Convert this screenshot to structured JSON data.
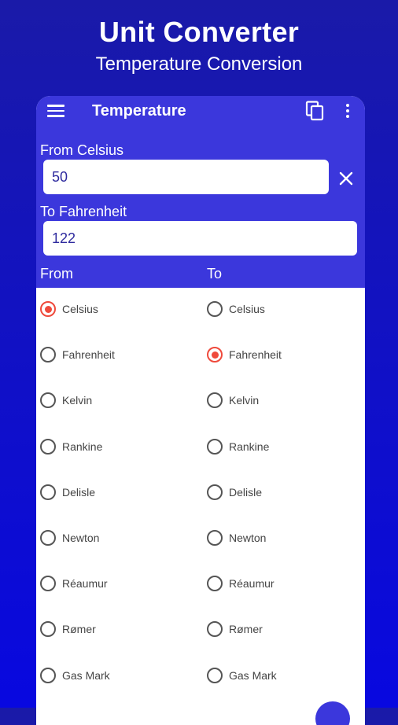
{
  "hero": {
    "title": "Unit Converter",
    "subtitle": "Temperature Conversion"
  },
  "appbar": {
    "title": "Temperature",
    "menu_icon": "menu-icon",
    "copy_icon": "copy-icon",
    "more_icon": "more-vert-icon"
  },
  "from_field": {
    "label": "From Celsius",
    "value": "50",
    "clear_icon": "close-icon"
  },
  "to_field": {
    "label": "To Fahrenheit",
    "value": "122"
  },
  "columns": {
    "from": "From",
    "to": "To"
  },
  "units": [
    "Celsius",
    "Fahrenheit",
    "Kelvin",
    "Rankine",
    "Delisle",
    "Newton",
    "Réaumur",
    "Rømer",
    "Gas Mark"
  ],
  "selected_from": "Celsius",
  "selected_to": "Fahrenheit",
  "colors": {
    "accent": "#3b37dc",
    "radio_selected": "#ef4a3c",
    "background": "#1010c8"
  }
}
